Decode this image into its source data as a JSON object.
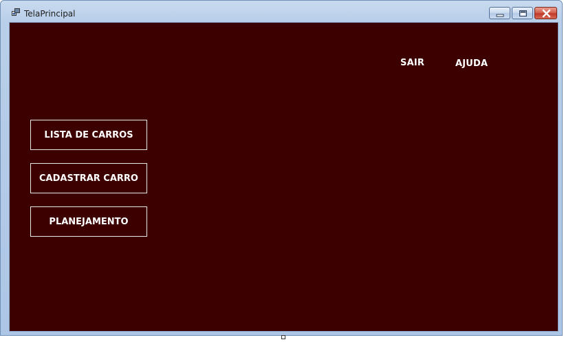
{
  "window": {
    "title": "TelaPrincipal"
  },
  "header_links": {
    "exit_label": "SAIR",
    "help_label": "AJUDA"
  },
  "menu": {
    "buttons": [
      {
        "label": "LISTA DE CARROS"
      },
      {
        "label": "CADASTRAR CARRO"
      },
      {
        "label": "PLANEJAMENTO"
      }
    ]
  },
  "colors": {
    "background": "#3c0000",
    "text": "#ffffff",
    "button_border": "#e8e8e8"
  }
}
